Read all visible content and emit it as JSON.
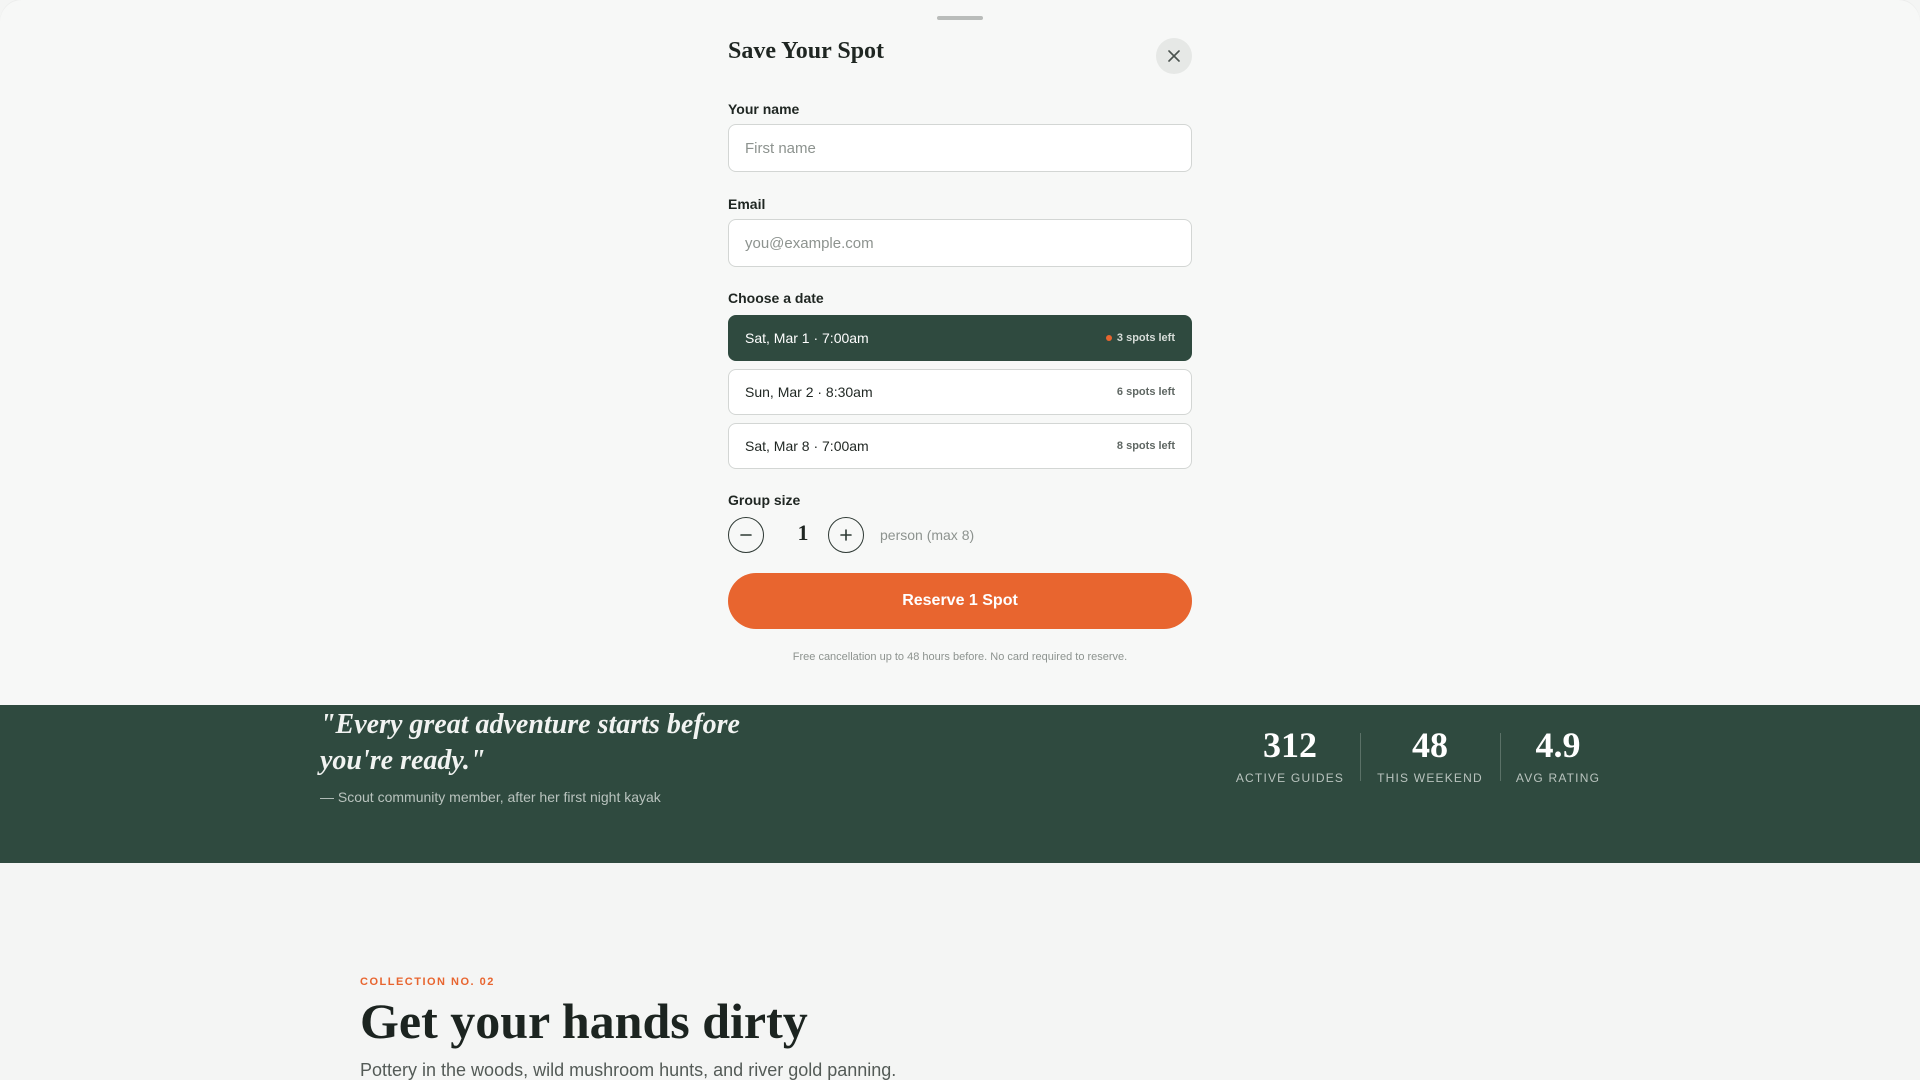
{
  "modal": {
    "title": "Save Your Spot",
    "close_icon": "close-icon",
    "name": {
      "label": "Your name",
      "value": "",
      "placeholder": "First name"
    },
    "email": {
      "label": "Email",
      "value": "",
      "placeholder": "you@example.com"
    },
    "date": {
      "label": "Choose a date",
      "options": [
        {
          "text": "Sat, Mar 1 · 7:00am",
          "spots": "3 spots left",
          "selected": true
        },
        {
          "text": "Sun, Mar 2 · 8:30am",
          "spots": "6 spots left",
          "selected": false
        },
        {
          "text": "Sat, Mar 8 · 7:00am",
          "spots": "8 spots left",
          "selected": false
        }
      ]
    },
    "group": {
      "label": "Group size",
      "decrement": "−",
      "increment": "+",
      "value": "1",
      "note": "person (max 8)"
    },
    "reserve_label": "Reserve 1 Spot",
    "fine_print": "Free cancellation up to 48 hours before. No card required to reserve."
  },
  "testimonial": {
    "quote": "\"Every great adventure starts before you're ready.\"",
    "attribution": "— Scout community member, after her first night kayak"
  },
  "stats": [
    {
      "value": "312",
      "label": "ACTIVE GUIDES"
    },
    {
      "value": "48",
      "label": "THIS WEEKEND"
    },
    {
      "value": "4.9",
      "label": "AVG RATING"
    }
  ],
  "collection": {
    "eyebrow": "COLLECTION NO. 02",
    "title": "Get your hands dirty",
    "subtitle": "Pottery in the woods, wild mushroom hunts, and river gold panning."
  },
  "colors": {
    "accent": "#e8652f",
    "forest": "#2f4a3f",
    "background": "#f4f5f4"
  }
}
